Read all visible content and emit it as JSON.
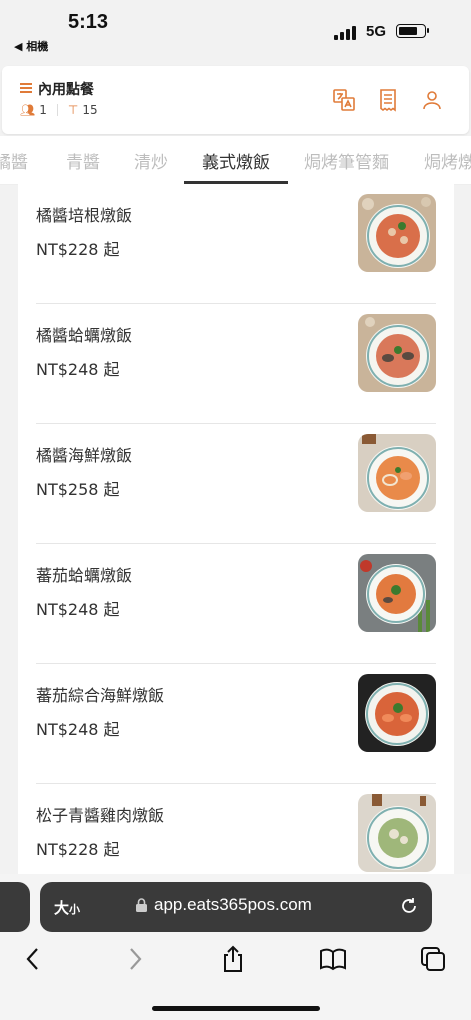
{
  "status_bar": {
    "time": "5:13",
    "back_label": "◀ 相機",
    "network": "5G"
  },
  "header": {
    "title": "內用點餐",
    "guests": "1",
    "table": "15",
    "icons": [
      "translate-icon",
      "receipt-icon",
      "user-icon"
    ]
  },
  "tabs": [
    {
      "label": "橘醬"
    },
    {
      "label": "青醬"
    },
    {
      "label": "清炒"
    },
    {
      "label": "義式燉飯",
      "active": true
    },
    {
      "label": "焗烤筆管麵"
    },
    {
      "label": "焗烤燉"
    }
  ],
  "menu_items": [
    {
      "name": "橘醬培根燉飯",
      "price": "NT$228 起"
    },
    {
      "name": "橘醬蛤蠣燉飯",
      "price": "NT$248 起"
    },
    {
      "name": "橘醬海鮮燉飯",
      "price": "NT$258 起"
    },
    {
      "name": "蕃茄蛤蠣燉飯",
      "price": "NT$248 起"
    },
    {
      "name": "蕃茄綜合海鮮燉飯",
      "price": "NT$248 起"
    },
    {
      "name": "松子青醬雞肉燉飯",
      "price": "NT$228 起"
    }
  ],
  "browser": {
    "text_size_label": "大",
    "text_size_small": "小",
    "url": "app.eats365pos.com"
  },
  "colors": {
    "accent": "#e07b39",
    "text": "#333333",
    "inactive_tab": "#bdbdbd"
  }
}
